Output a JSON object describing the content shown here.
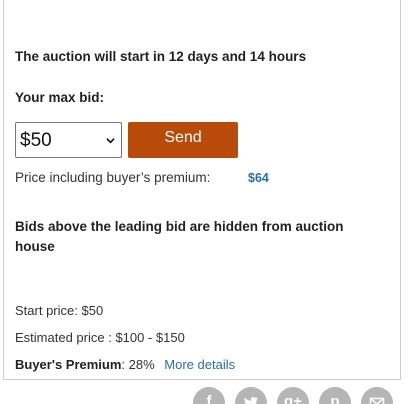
{
  "auction": {
    "start_notice": "The auction will start in 12 days and 14 hours",
    "max_bid_label": "Your max bid:",
    "bid_select": {
      "selected_value": "$50"
    },
    "send_label": "Send",
    "premium_label": "Price including buyer’s premium:",
    "premium_value": "$64",
    "hidden_bids_notice": "Bids above the leading bid are hidden from auction house"
  },
  "details": {
    "start_price_label": "Start price:",
    "start_price_value": "$50",
    "estimate_label": "Estimated price :",
    "estimate_value": "$100 - $150",
    "buyers_premium_label": "Buyer's Premium",
    "buyers_premium_value": ": 28%",
    "more_details_label": "More details"
  },
  "share": {
    "facebook_letter": "f",
    "google_plus_label": "g+",
    "pinterest_letter": "p"
  },
  "colors": {
    "send_button": "#b84a0a",
    "link": "#2a6db0",
    "share_icon_bg": "#b5b5b5"
  }
}
